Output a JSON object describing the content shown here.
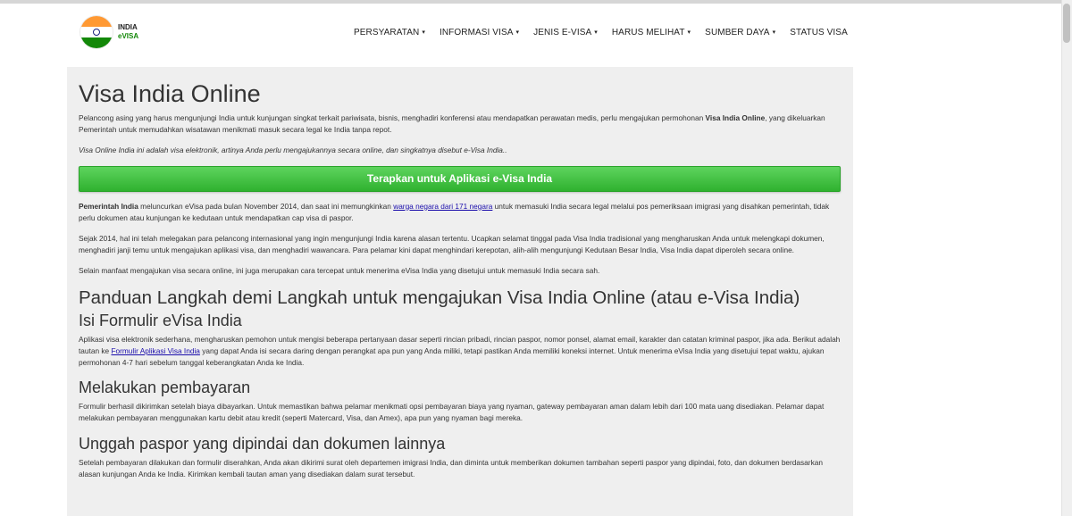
{
  "logo": {
    "line1": "INDIA",
    "line2": "eVISA"
  },
  "nav": {
    "items": [
      {
        "label": "PERSYARATAN",
        "dropdown": true
      },
      {
        "label": "INFORMASI VISA",
        "dropdown": true
      },
      {
        "label": "JENIS E-VISA",
        "dropdown": true
      },
      {
        "label": "HARUS MELIHAT",
        "dropdown": true
      },
      {
        "label": "SUMBER DAYA",
        "dropdown": true
      },
      {
        "label": "STATUS VISA",
        "dropdown": false
      }
    ],
    "caret": "▾"
  },
  "main": {
    "title": "Visa India Online",
    "intro": {
      "text_a": "Pelancong asing yang harus mengunjungi India untuk kunjungan singkat terkait pariwisata, bisnis, menghadiri konferensi atau mendapatkan perawatan medis, perlu mengajukan permohonan ",
      "bold": "Visa India Online",
      "text_b": ", yang dikeluarkan Pemerintah untuk memudahkan wisatawan menikmati masuk secara legal ke India tanpa repot."
    },
    "italic_note": "Visa Online India ini adalah visa elektronik, artinya Anda perlu mengajukannya secara online, dan singkatnya disebut e-Visa India..",
    "cta_label": "Terapkan untuk Aplikasi e-Visa India",
    "p1": {
      "bold": "Pemerintah India",
      "text_a": " meluncurkan eVisa pada bulan November 2014, dan saat ini memungkinkan ",
      "link": "warga negara dari 171 negara",
      "text_b": " untuk memasuki India secara legal melalui pos pemeriksaan imigrasi yang disahkan pemerintah, tidak perlu dokumen atau kunjungan ke kedutaan untuk mendapatkan cap visa di paspor."
    },
    "p2": "Sejak 2014, hal ini telah melegakan para pelancong internasional yang ingin mengunjungi India karena alasan tertentu. Ucapkan selamat tinggal pada Visa India tradisional yang mengharuskan Anda untuk melengkapi dokumen, menghadiri janji temu untuk mengajukan aplikasi visa, dan menghadiri wawancara. Para pelamar kini dapat menghindari kerepotan, alih-alih mengunjungi Kedutaan Besar India, Visa India dapat diperoleh secara online.",
    "p3": "Selain manfaat mengajukan visa secara online, ini juga merupakan cara tercepat untuk menerima eVisa India yang disetujui untuk memasuki India secara sah.",
    "guide_heading": "Panduan Langkah demi Langkah untuk mengajukan Visa India Online (atau e-Visa India)",
    "step1": {
      "heading": "Isi Formulir eVisa India",
      "text_a": "Aplikasi visa elektronik sederhana, mengharuskan pemohon untuk mengisi beberapa pertanyaan dasar seperti rincian pribadi, rincian paspor, nomor ponsel, alamat email, karakter dan catatan kriminal paspor, jika ada. Berikut adalah tautan ke ",
      "link": "Formulir Aplikasi Visa India",
      "text_b": " yang dapat Anda isi secara daring dengan perangkat apa pun yang Anda miliki, tetapi pastikan Anda memiliki koneksi internet. Untuk menerima eVisa India yang disetujui tepat waktu, ajukan permohonan 4-7 hari sebelum tanggal keberangkatan Anda ke India."
    },
    "step2": {
      "heading": "Melakukan pembayaran",
      "text": "Formulir berhasil dikirimkan setelah biaya dibayarkan. Untuk memastikan bahwa pelamar menikmati opsi pembayaran biaya yang nyaman, gateway pembayaran aman dalam lebih dari 100 mata uang disediakan. Pelamar dapat melakukan pembayaran menggunakan kartu debit atau kredit (seperti Matercard, Visa, dan Amex), apa pun yang nyaman bagi mereka."
    },
    "step3": {
      "heading": "Unggah paspor yang dipindai dan dokumen lainnya",
      "text": "Setelah pembayaran dilakukan dan formulir diserahkan, Anda akan dikirimi surat oleh departemen imigrasi India, dan diminta untuk memberikan dokumen tambahan seperti paspor yang dipindai, foto, dan dokumen berdasarkan alasan kunjungan Anda ke India. Kirimkan kembali tautan aman yang disediakan dalam surat tersebut."
    }
  },
  "colors": {
    "cta_green": "#3cbc3c",
    "content_bg": "#efefef",
    "link": "#1a0dab"
  }
}
